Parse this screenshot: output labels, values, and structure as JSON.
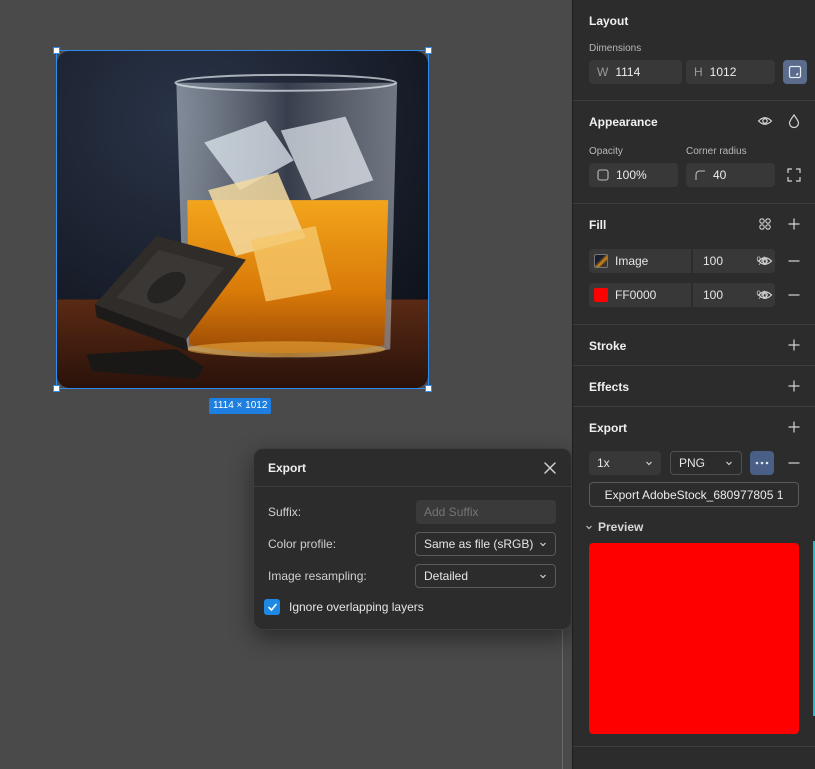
{
  "canvas": {
    "size_label": "1114 × 1012"
  },
  "export_popover": {
    "title": "Export",
    "suffix_label": "Suffix:",
    "suffix_placeholder": "Add Suffix",
    "color_profile_label": "Color profile:",
    "color_profile_value": "Same as file (sRGB)",
    "resampling_label": "Image resampling:",
    "resampling_value": "Detailed",
    "ignore_overlap_label": "Ignore overlapping layers",
    "ignore_overlap_checked": true
  },
  "panel": {
    "layout": {
      "title": "Layout",
      "dimensions_label": "Dimensions",
      "w_prefix": "W",
      "w_value": "1114",
      "h_prefix": "H",
      "h_value": "1012"
    },
    "appearance": {
      "title": "Appearance",
      "opacity_label": "Opacity",
      "opacity_value": "100%",
      "radius_label": "Corner radius",
      "radius_value": "40"
    },
    "fill": {
      "title": "Fill",
      "items": [
        {
          "name": "Image",
          "opacity": "100",
          "unit": "%",
          "swatch": "image"
        },
        {
          "name": "FF0000",
          "opacity": "100",
          "unit": "%",
          "swatch": "#FF0000"
        }
      ]
    },
    "stroke": {
      "title": "Stroke"
    },
    "effects": {
      "title": "Effects"
    },
    "export": {
      "title": "Export",
      "scale": "1x",
      "format": "PNG",
      "export_button": "Export AdobeStock_680977805 1",
      "preview_label": "Preview",
      "preview_color": "#FF0000"
    }
  },
  "colors": {
    "accent": "#2d8cf0",
    "panel_bg": "#2c2c2c",
    "canvas_bg": "#4a4a4a"
  }
}
